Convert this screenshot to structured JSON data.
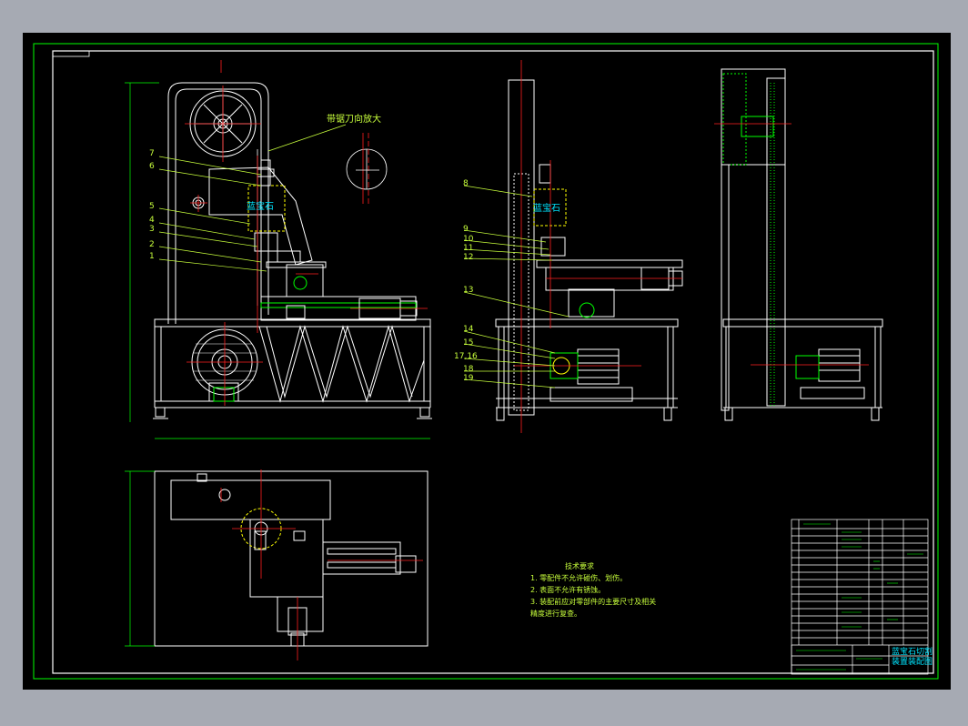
{
  "drawing": {
    "callout_text": "带锯刀向放大",
    "part_label_front": "蓝宝石",
    "part_label_side": "蓝宝石",
    "balloons_front": [
      "7",
      "6",
      "5",
      "4",
      "3",
      "2",
      "1"
    ],
    "balloons_side": [
      "8",
      "9",
      "10",
      "11",
      "12",
      "13",
      "14",
      "15",
      "17,16",
      "18",
      "19"
    ],
    "tech_requirements": {
      "heading": "技术要求",
      "lines": [
        "1. 零配件不允许碰伤、划伤。",
        "2. 表面不允许有锈蚀。",
        "3. 装配前应对零部件的主要尺寸及相关",
        "精度进行复查。"
      ]
    },
    "title_block": {
      "name_line1": "蓝宝石切割",
      "name_line2": "装置装配图"
    }
  },
  "colors": {
    "background": "#000000",
    "frame": "#00ff00",
    "linework": "#ffffff",
    "centerline": "#ff2020",
    "text": "#c8ff3c",
    "dashed": "#ffff00",
    "accent": "#00e5ff"
  }
}
